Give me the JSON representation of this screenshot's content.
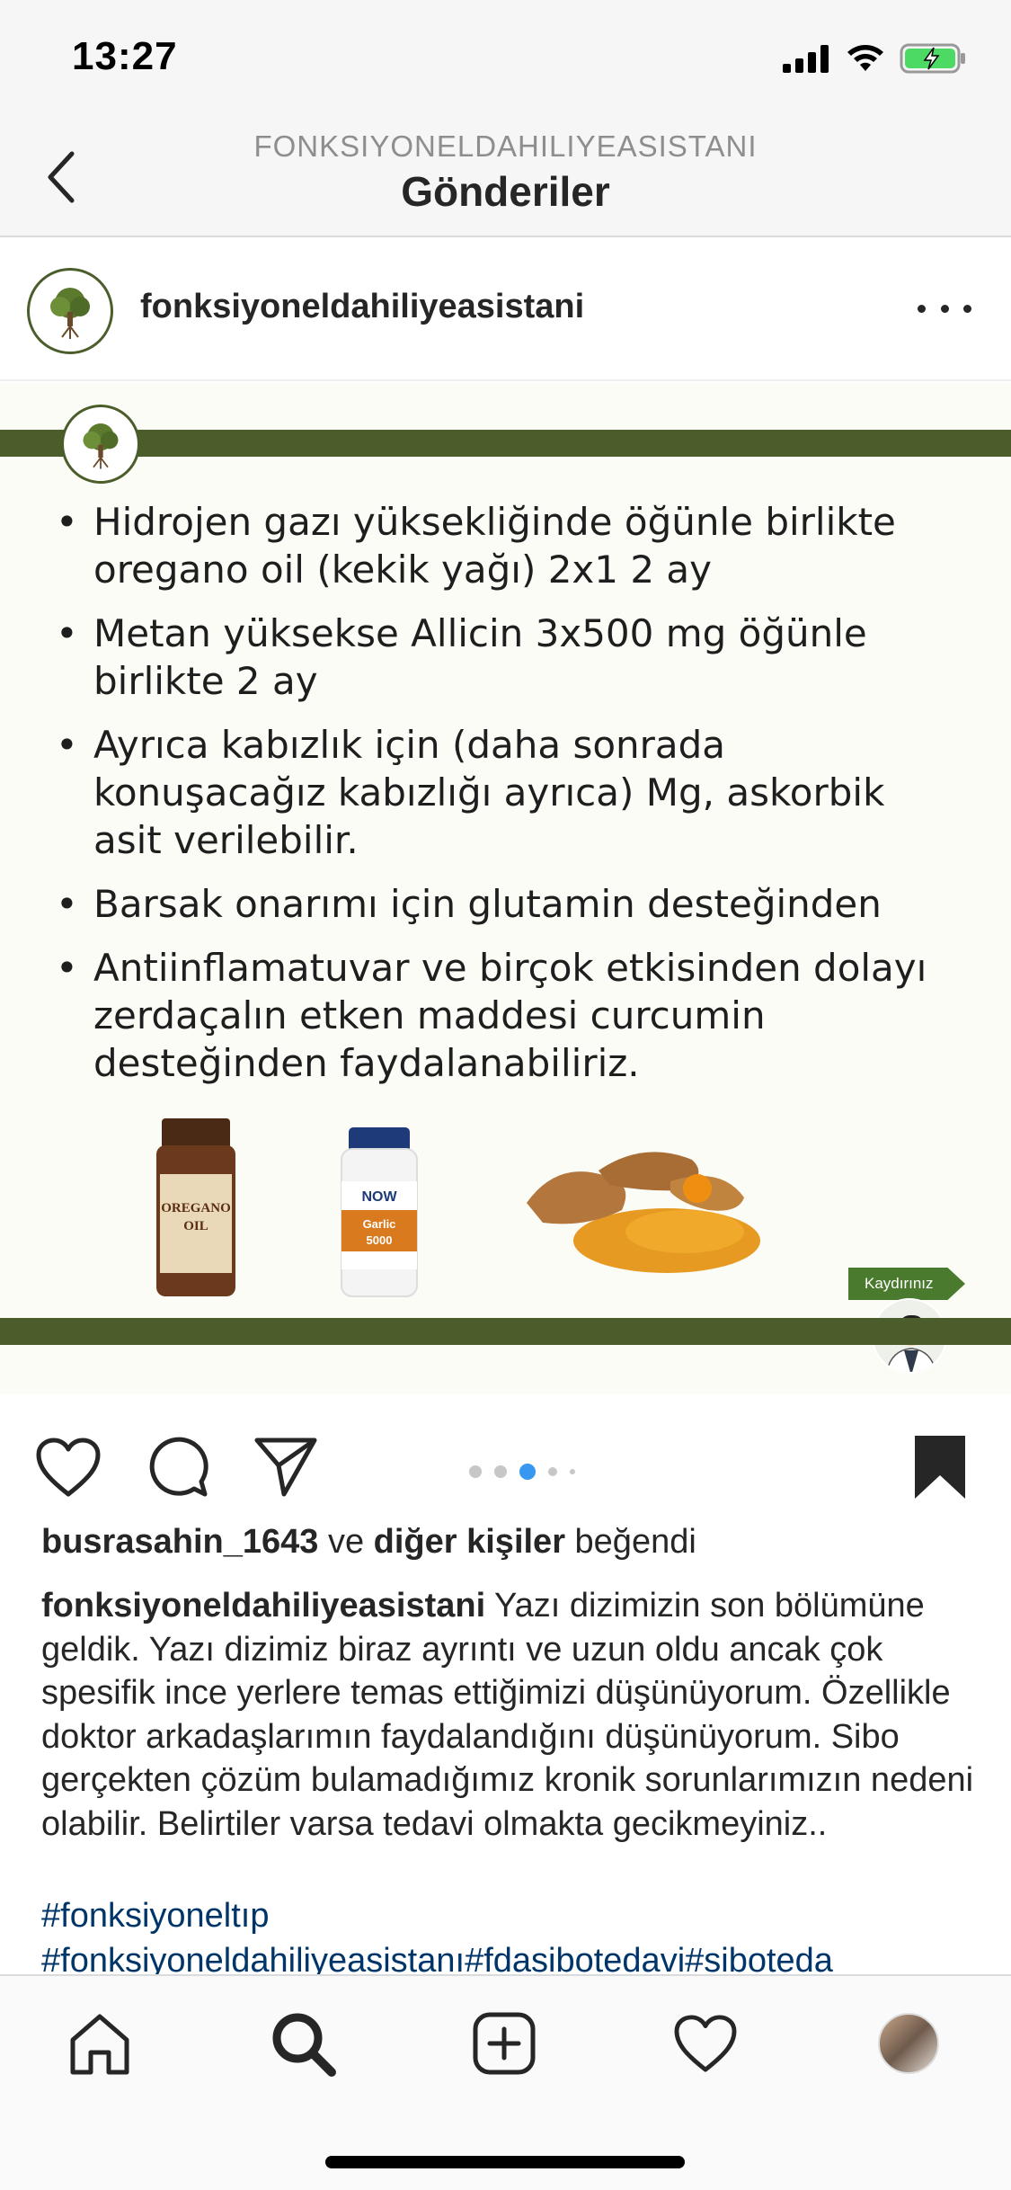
{
  "status_bar": {
    "time": "13:27",
    "icons": [
      "signal-icon",
      "wifi-icon",
      "battery-charging-icon"
    ]
  },
  "header": {
    "subtitle": "FONKSIYONELDAHILIYEASISTANI",
    "title": "Gönderiler",
    "back_icon": "chevron-left-icon"
  },
  "post": {
    "username": "fonksiyoneldahiliyeasistani",
    "more_icon": "more-horizontal-icon",
    "image": {
      "bullets": [
        "Hidrojen gazı yüksekliğinde öğünle birlikte oregano oil (kekik yağı) 2x1 2 ay",
        "Metan yüksekse Allicin 3x500 mg öğünle birlikte 2 ay",
        "Ayrıca kabızlık için (daha sonrada konuşacağız kabızlığı ayrıca) Mg, askorbik asit verilebilir.",
        "Barsak onarımı için glutamin desteğinden",
        "Antiinflamatuvar ve birçok etkisinden dolayı zerdaçalın etken maddesi curcumin desteğinden faydalanabiliriz."
      ],
      "product_labels": {
        "oregano_line1": "OREGANO",
        "oregano_line2": "OIL",
        "garlic_brand": "NOW",
        "garlic_name": "Garlic",
        "garlic_dose": "5000"
      },
      "swipe_label": "Kaydırınız"
    },
    "carousel": {
      "count": 5,
      "active_index": 2
    },
    "likes": {
      "user": "busrasahin_1643",
      "connector": " ve ",
      "others": "diğer kişiler",
      "suffix": " beğendi"
    },
    "caption": {
      "user": "fonksiyoneldahiliyeasistani",
      "text": " Yazı dizimizin son bölümüne geldik. Yazı dizimiz biraz ayrıntı ve uzun oldu ancak çok spesifik ince yerlere temas ettiğimizi düşünüyorum. Özellikle doktor arkadaşlarımın faydalandığını düşünüyorum. Sibo gerçekten çözüm bulamadığımız kronik sorunlarımızın nedeni olabilir. Belirtiler varsa tedavi olmakta gecikmeyiniz..",
      "hashtag_line1": "#fonksiyoneltıp",
      "hashtag_line2": "#fonksiyoneldahiliyeasistanı#fdasibotedavi#siboteda"
    }
  },
  "tab_bar": {
    "items": [
      "home-icon",
      "search-icon",
      "add-icon",
      "activity-heart-icon",
      "profile-avatar"
    ]
  },
  "colors": {
    "brand_green": "#4a5d2b",
    "link": "#003569",
    "active_dot": "#3897f0"
  }
}
